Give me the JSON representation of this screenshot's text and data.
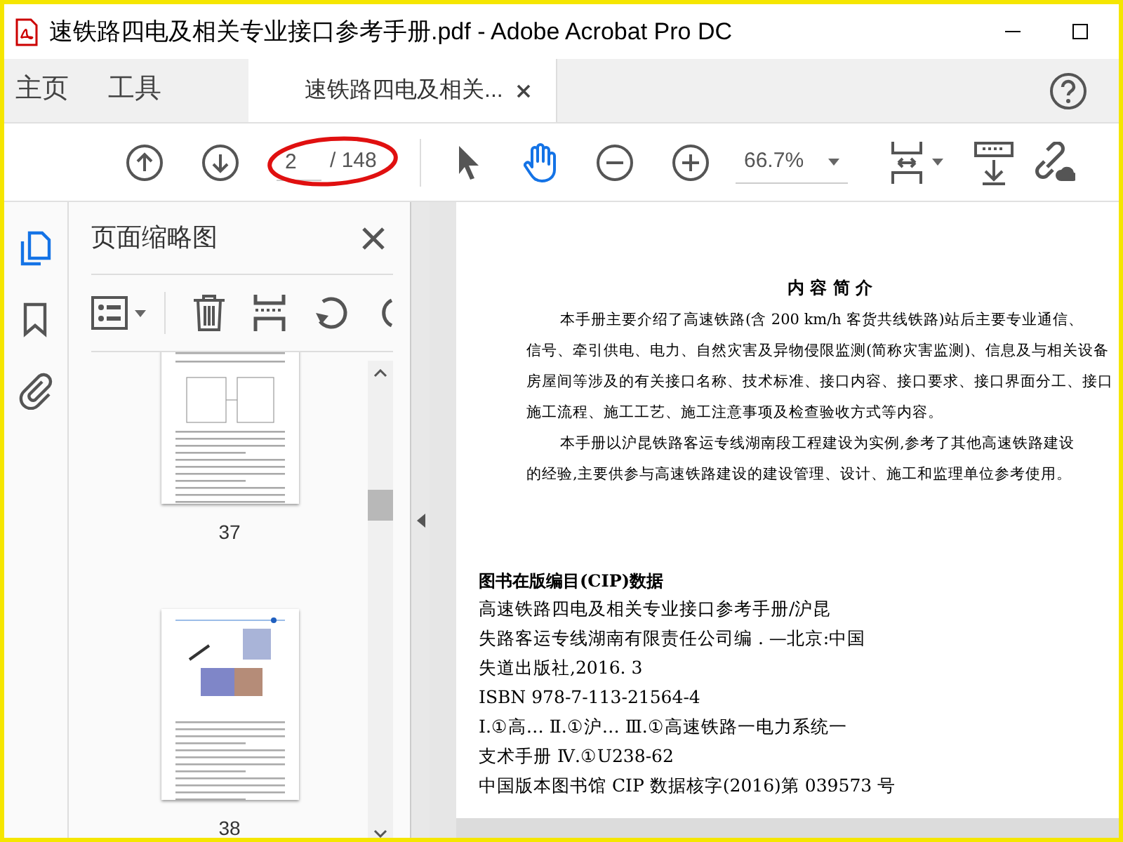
{
  "window": {
    "title": "速铁路四电及相关专业接口参考手册.pdf - Adobe Acrobat Pro DC"
  },
  "tabs": [
    {
      "label": "主页",
      "selected": false
    },
    {
      "label": "工具",
      "selected": false
    },
    {
      "label": "速铁路四电及相关...",
      "selected": true
    }
  ],
  "toolbar": {
    "page_number": "2",
    "page_total": "/ 148",
    "zoom": "66.7%",
    "hand_tool_selected": true
  },
  "side_rail": [
    {
      "kind": "pages",
      "selected": true
    },
    {
      "kind": "bookmark",
      "selected": false
    },
    {
      "kind": "attachment",
      "selected": false
    }
  ],
  "panel": {
    "title": "页面缩略图",
    "thumbnails": [
      {
        "label": "37",
        "kind": "diagram"
      },
      {
        "label": "38",
        "kind": "photos"
      }
    ]
  },
  "document": {
    "heading": "内 容 简 介",
    "paragraphs": [
      [
        "本手册主要介绍了高速铁路(含 200 km/h 客货共线铁路)站后主要专业通信、",
        "信号、牵引供电、电力、自然灾害及异物侵限监测(简称灾害监测)、信息及与相关设备",
        "房屋间等涉及的有关接口名称、技术标准、接口内容、接口要求、接口界面分工、接口",
        "施工流程、施工工艺、施工注意事项及检查验收方式等内容。"
      ],
      [
        "本手册以沪昆铁路客运专线湖南段工程建设为实例,参考了其他高速铁路建设",
        "的经验,主要供参与高速铁路建设的建设管理、设计、施工和监理单位参考使用。"
      ]
    ],
    "cip_title": "图书在版编目(CIP)数据",
    "cip_lines": [
      "高速铁路四电及相关专业接口参考手册/沪昆",
      "失路客运专线湖南有限责任公司编 . —北京:中国",
      "失道出版社,2016. 3",
      "ISBN 978-7-113-21564-4",
      "Ⅰ.①高… Ⅱ.①沪… Ⅲ.①高速铁路一电力系统一",
      "支术手册 Ⅳ.①U238-62",
      "中国版本图书馆 CIP 数据核字(2016)第 039573 号"
    ]
  }
}
